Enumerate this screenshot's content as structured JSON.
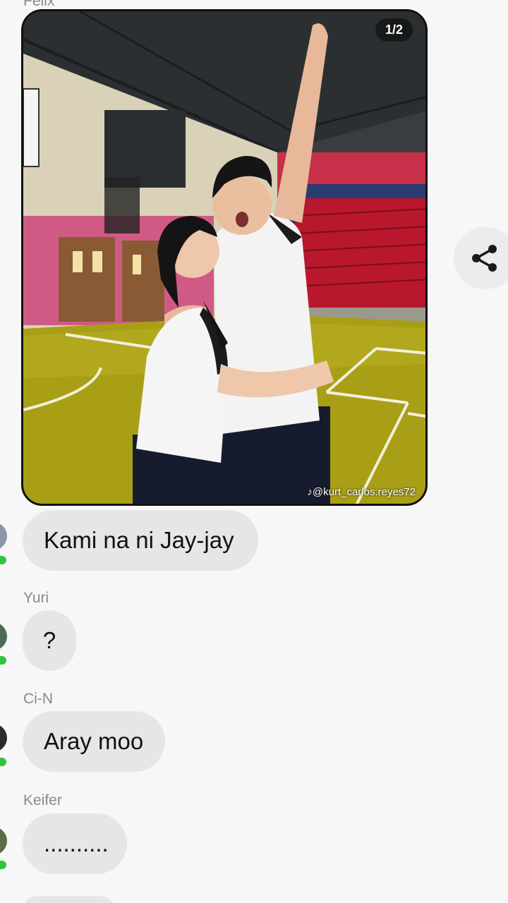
{
  "chat": {
    "top_sender": "Felix",
    "photo": {
      "counter": "1/2",
      "watermark": "@kurt_carlos.reyes72"
    },
    "messages": [
      {
        "sender": "",
        "text": "Kami na ni Jay-jay"
      },
      {
        "sender": "Yuri",
        "text": "?"
      },
      {
        "sender": "Ci-N",
        "text": "Aray moo"
      },
      {
        "sender": "Keifer",
        "text": ".........."
      }
    ]
  },
  "icons": {
    "share": "share-icon"
  },
  "colors": {
    "bubble": "#e6e6e8",
    "online": "#31c53f",
    "background": "#f7f7f8"
  }
}
